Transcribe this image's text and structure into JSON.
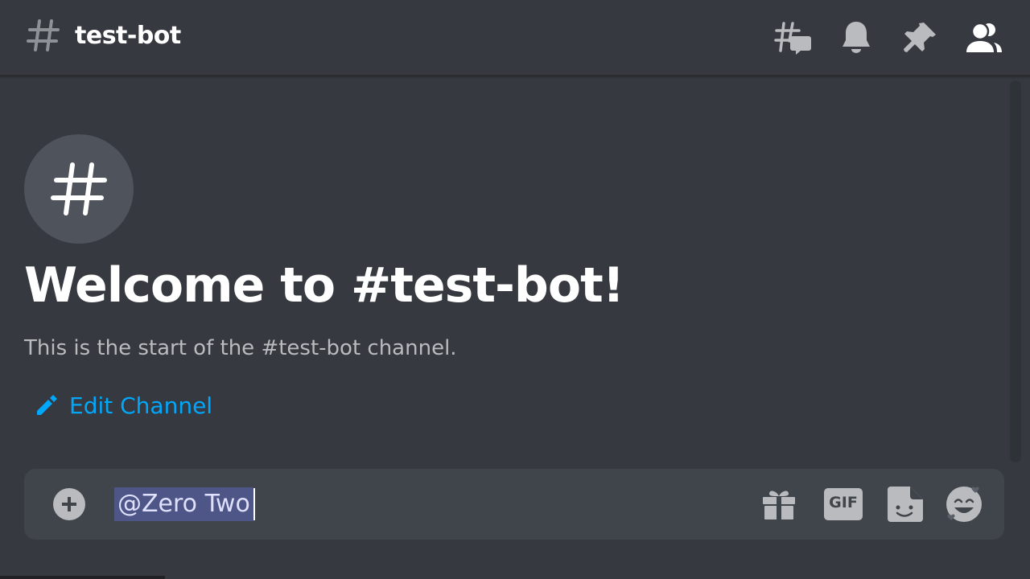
{
  "header": {
    "channel_name": "test-bot",
    "icons": [
      "hash-icon",
      "threads-icon",
      "notification-bell-icon",
      "pin-icon",
      "member-list-icon"
    ]
  },
  "channel_intro": {
    "avatar_icon": "hash-icon",
    "welcome_title": "Welcome to #test-bot!",
    "start_text": "This is the start of the #test-bot channel.",
    "edit_channel_label": "Edit Channel",
    "edit_icon": "pencil-icon"
  },
  "composer": {
    "add_icon": "plus-circle-icon",
    "input_value": "@Zero Two",
    "icons": [
      "gift-icon",
      "gif-icon",
      "sticker-icon",
      "emoji-icon"
    ],
    "gif_label": "GIF"
  },
  "colors": {
    "background": "#36393f",
    "composer_bg": "#40444b",
    "link": "#00a8fc",
    "mention_bg": "#4e5587",
    "icon": "#b9bbbe"
  }
}
